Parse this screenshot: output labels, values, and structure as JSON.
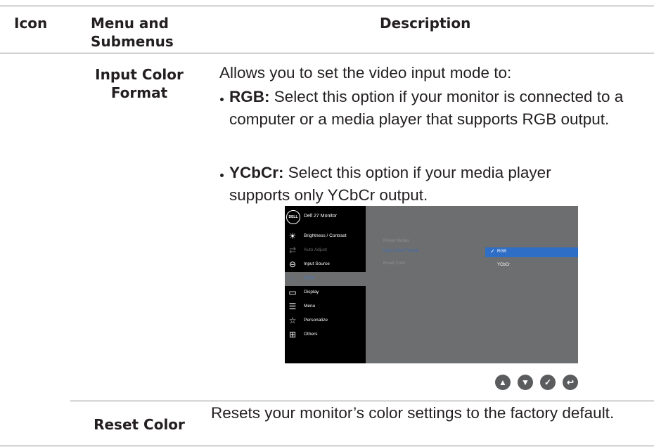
{
  "table": {
    "headers": {
      "icon": "Icon",
      "menu": "Menu and\nSubmenus",
      "description": "Description"
    },
    "rows": [
      {
        "menu": "Input Color\nFormat",
        "intro": "Allows you to set the video input mode to:",
        "bullets": [
          {
            "term": "RGB:",
            "text": " Select this option if your monitor is connected to a computer or a media player that supports RGB output."
          },
          {
            "term": "YCbCr:",
            "text": " Select this option if your media player supports only YCbCr output."
          }
        ]
      },
      {
        "menu": "Reset Color",
        "description": "Resets your monitor’s color settings to the factory default."
      }
    ]
  },
  "osd": {
    "logo": "DELL",
    "title": "Dell 27 Monitor",
    "menu_items": [
      {
        "label": "Brightness / Contrast",
        "icon": "brightness-icon",
        "state": "normal"
      },
      {
        "label": "Auto Adjust",
        "icon": "auto-adjust-icon",
        "state": "dim"
      },
      {
        "label": "Input Source",
        "icon": "input-source-icon",
        "state": "normal"
      },
      {
        "label": "Color",
        "icon": "color-icon",
        "state": "selected"
      },
      {
        "label": "Display",
        "icon": "display-icon",
        "state": "normal"
      },
      {
        "label": "Menu",
        "icon": "menu-icon",
        "state": "normal"
      },
      {
        "label": "Personalize",
        "icon": "star-icon",
        "state": "normal"
      },
      {
        "label": "Others",
        "icon": "others-icon",
        "state": "normal"
      }
    ],
    "submenu": [
      "Preset Modes",
      "Input Color Format",
      "Reset Color"
    ],
    "options": [
      {
        "label": "RGB",
        "selected": true
      },
      {
        "label": "YCbCr",
        "selected": false
      }
    ],
    "colors": {
      "menu_bg": "#000000",
      "panel_bg": "#6d6e70",
      "highlight": "#2f6ec6",
      "selected_text": "#4a7fc1"
    }
  },
  "nav_buttons": [
    "up-arrow-icon",
    "down-arrow-icon",
    "check-icon",
    "back-icon"
  ]
}
